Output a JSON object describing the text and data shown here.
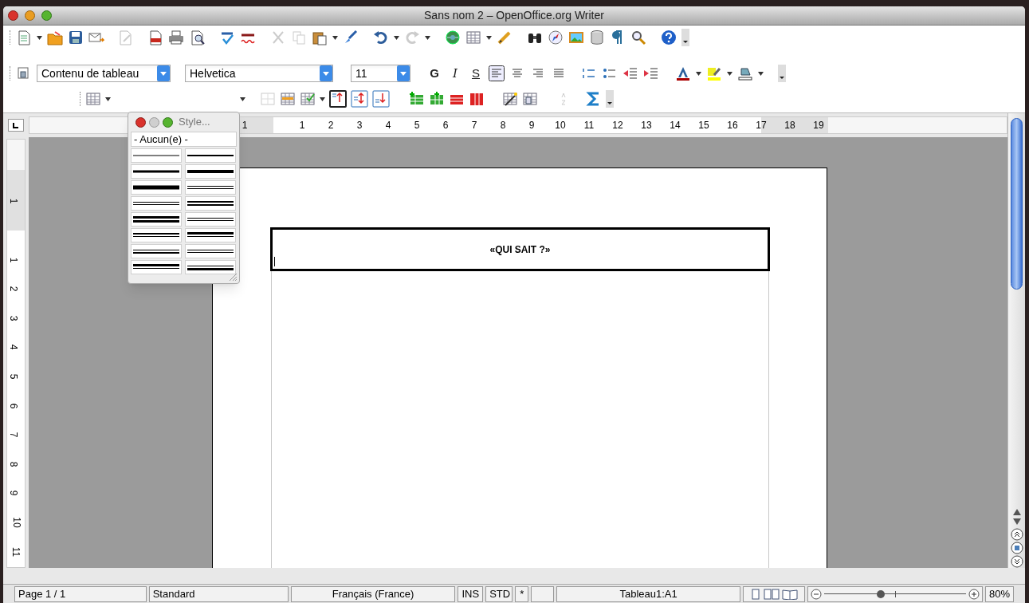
{
  "window": {
    "title": "Sans nom 2 – OpenOffice.org Writer"
  },
  "formatting_toolbar": {
    "paragraph_style": "Contenu de tableau",
    "font_name": "Helvetica",
    "font_size": "11",
    "bold": "G",
    "italic": "I",
    "underline": "S",
    "alignment": [
      {
        "selected": true
      },
      {
        "selected": false
      },
      {
        "selected": false
      },
      {
        "selected": false
      }
    ]
  },
  "table_toolbar": {
    "vertical_alignment": [
      {
        "selected": true
      },
      {
        "selected": false
      },
      {
        "selected": false
      }
    ]
  },
  "borders_panel": {
    "title": "Style...",
    "none_option": "- Aucun(e) -"
  },
  "ruler": {
    "horizontal_labels": [
      "1",
      "1",
      "2",
      "3",
      "4",
      "5",
      "6",
      "7",
      "8",
      "9",
      "10",
      "11",
      "12",
      "13",
      "14",
      "15",
      "16",
      "17",
      "18",
      "19"
    ],
    "vertical_labels": [
      "1",
      "1",
      "2",
      "3",
      "4",
      "5",
      "6",
      "7",
      "8",
      "9",
      "10",
      "11"
    ]
  },
  "document": {
    "table_cell": "«QUI SAIT ?»"
  },
  "status_bar": {
    "page": "Page 1 / 1",
    "page_style": "Standard",
    "language": "Français (France)",
    "insert_mode": "INS",
    "selection_mode": "STD",
    "modified": "*",
    "cell": "Tableau1:A1",
    "zoom": {
      "level": 0.4,
      "reading": "80%"
    }
  }
}
